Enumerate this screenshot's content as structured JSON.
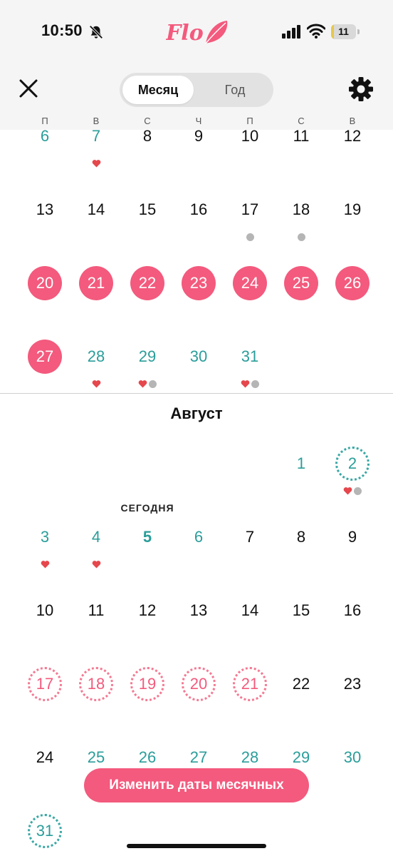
{
  "status": {
    "time": "10:50",
    "battery": "11",
    "battery_level": 0.11
  },
  "header": {
    "logo": "Flo",
    "tabs": {
      "month": "Месяц",
      "year": "Год"
    },
    "active_tab": "month"
  },
  "weekdays": [
    "П",
    "В",
    "С",
    "Ч",
    "П",
    "С",
    "В"
  ],
  "month2_title": "Август",
  "today_label": "СЕГОДНЯ",
  "month1_days": [
    {
      "d": "6",
      "style": "teal"
    },
    {
      "d": "7",
      "style": "teal",
      "heart": true
    },
    {
      "d": "8",
      "style": "dark"
    },
    {
      "d": "9",
      "style": "dark"
    },
    {
      "d": "10",
      "style": "dark"
    },
    {
      "d": "11",
      "style": "dark"
    },
    {
      "d": "12",
      "style": "dark"
    },
    {
      "d": "13",
      "style": "dark"
    },
    {
      "d": "14",
      "style": "dark"
    },
    {
      "d": "15",
      "style": "dark"
    },
    {
      "d": "16",
      "style": "dark"
    },
    {
      "d": "17",
      "style": "dark",
      "dot": true
    },
    {
      "d": "18",
      "style": "dark",
      "dot": true
    },
    {
      "d": "19",
      "style": "dark"
    },
    {
      "d": "20",
      "style": "period"
    },
    {
      "d": "21",
      "style": "period"
    },
    {
      "d": "22",
      "style": "period"
    },
    {
      "d": "23",
      "style": "period"
    },
    {
      "d": "24",
      "style": "period"
    },
    {
      "d": "25",
      "style": "period"
    },
    {
      "d": "26",
      "style": "period"
    },
    {
      "d": "27",
      "style": "period"
    },
    {
      "d": "28",
      "style": "teal",
      "heart": true
    },
    {
      "d": "29",
      "style": "teal",
      "heart": true,
      "dot": true
    },
    {
      "d": "30",
      "style": "teal"
    },
    {
      "d": "31",
      "style": "teal",
      "heart": true,
      "dot": true
    }
  ],
  "month2_days": [
    {
      "d": "1",
      "style": "teal"
    },
    {
      "d": "2",
      "style": "ovul",
      "heart": true,
      "dot": true
    },
    {
      "d": "3",
      "style": "teal",
      "heart": true
    },
    {
      "d": "4",
      "style": "teal",
      "heart": true
    },
    {
      "d": "5",
      "style": "teal bold",
      "today": true
    },
    {
      "d": "6",
      "style": "teal"
    },
    {
      "d": "7",
      "style": "dark"
    },
    {
      "d": "8",
      "style": "dark"
    },
    {
      "d": "9",
      "style": "dark"
    },
    {
      "d": "10",
      "style": "dark"
    },
    {
      "d": "11",
      "style": "dark"
    },
    {
      "d": "12",
      "style": "dark"
    },
    {
      "d": "13",
      "style": "dark"
    },
    {
      "d": "14",
      "style": "dark"
    },
    {
      "d": "15",
      "style": "dark"
    },
    {
      "d": "16",
      "style": "dark"
    },
    {
      "d": "17",
      "style": "predicted"
    },
    {
      "d": "18",
      "style": "predicted"
    },
    {
      "d": "19",
      "style": "predicted"
    },
    {
      "d": "20",
      "style": "predicted"
    },
    {
      "d": "21",
      "style": "predicted"
    },
    {
      "d": "22",
      "style": "dark"
    },
    {
      "d": "23",
      "style": "dark"
    },
    {
      "d": "24",
      "style": "dark"
    },
    {
      "d": "25",
      "style": "teal"
    },
    {
      "d": "26",
      "style": "teal"
    },
    {
      "d": "27",
      "style": "teal"
    },
    {
      "d": "28",
      "style": "teal"
    },
    {
      "d": "29",
      "style": "teal"
    },
    {
      "d": "30",
      "style": "teal"
    },
    {
      "d": "31",
      "style": "ovul"
    }
  ],
  "edit_button": "Изменить даты месячных",
  "colors": {
    "period": "#f35a7d",
    "fertile": "#2a9d9a",
    "heart": "#e5474d",
    "dot": "#b5b5b5"
  }
}
